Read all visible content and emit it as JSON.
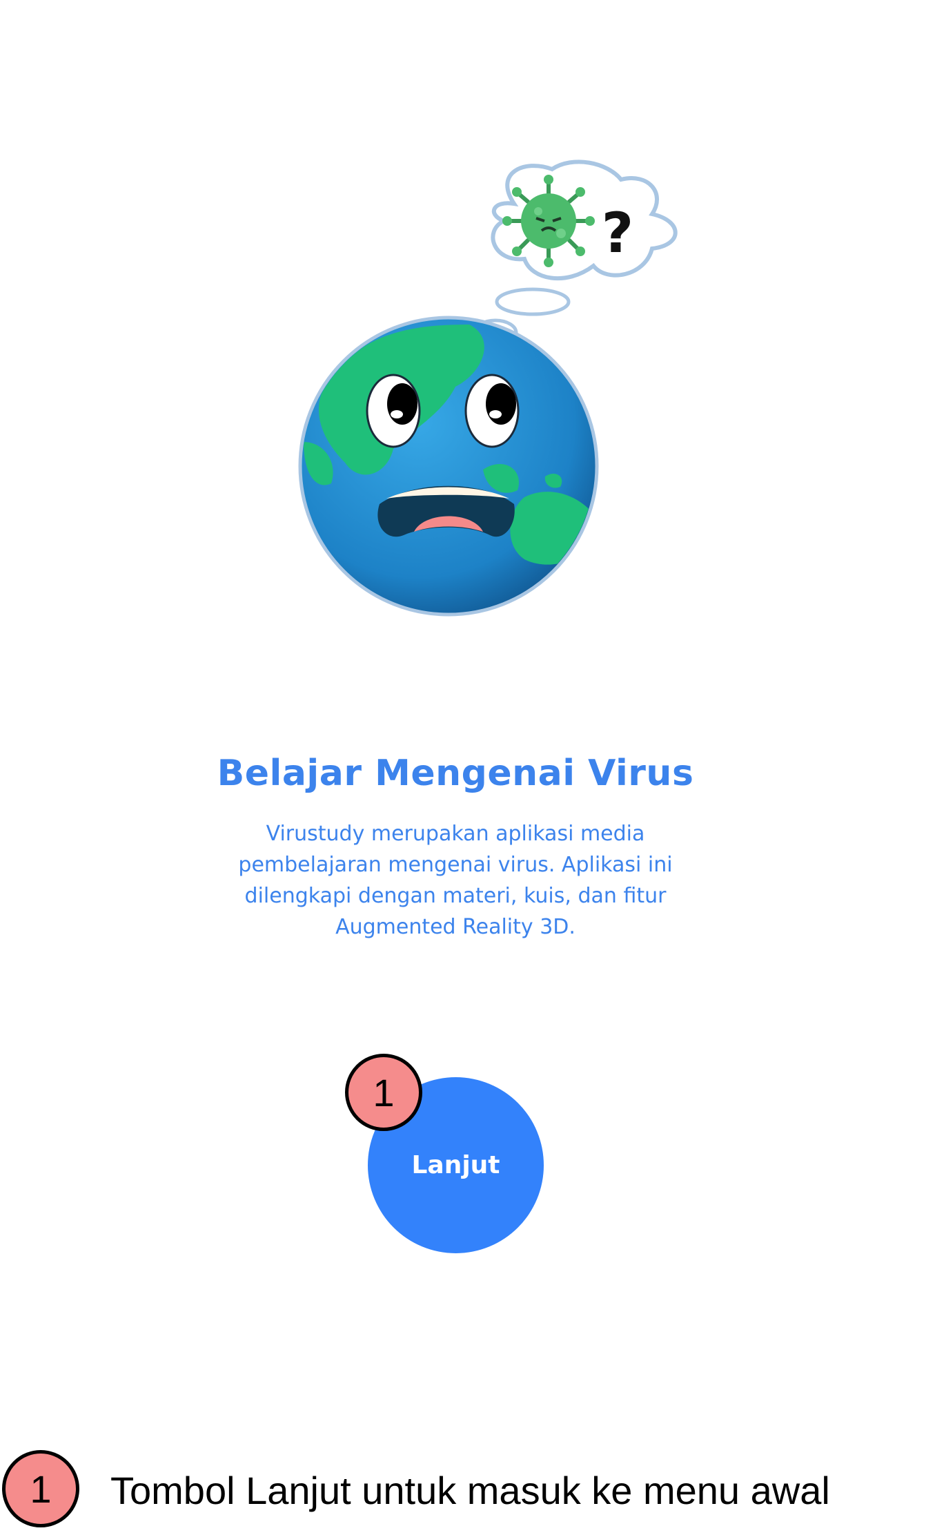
{
  "illustration": {
    "name": "worried-earth-with-virus-thought",
    "thought_symbol": "?",
    "colors": {
      "ocean": "#1E8ACB",
      "land": "#1FBF7A",
      "virus": "#4CBB6C",
      "cloud_outline": "#A9C6E3"
    }
  },
  "heading": {
    "title": "Belajar Mengenai Virus"
  },
  "description": {
    "lines": [
      "Virustudy merupakan aplikasi media",
      "pembelajaran mengenai virus. Aplikasi ini",
      "dilengkapi dengan materi, kuis, dan fitur",
      "Augmented Reality 3D."
    ]
  },
  "next_button": {
    "label": "Lanjut"
  },
  "annotation": {
    "badge_number": "1",
    "legend_text": "Tombol Lanjut untuk masuk ke menu awal"
  },
  "colors": {
    "accent": "#3C83EC",
    "button": "#3382FB",
    "badge": "#F58C8C"
  }
}
